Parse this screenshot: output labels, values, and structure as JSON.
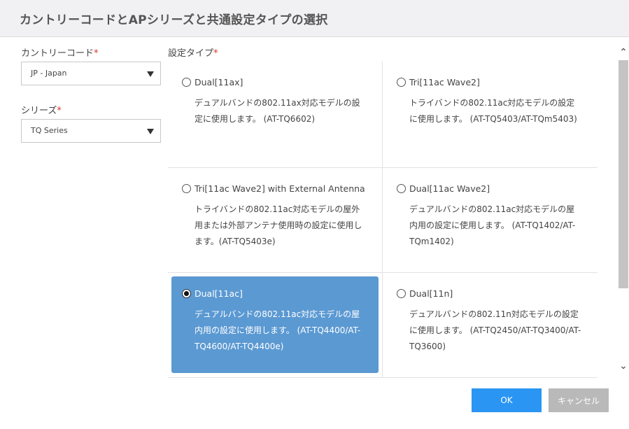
{
  "dialog": {
    "title": "カントリーコードとAPシリーズと共通設定タイプの選択"
  },
  "country": {
    "label": "カントリーコード",
    "required_mark": "*",
    "value": "JP - Japan"
  },
  "series": {
    "label": "シリーズ",
    "required_mark": "*",
    "value": "TQ Series"
  },
  "settings_type": {
    "label": "設定タイプ",
    "required_mark": "*",
    "options": [
      {
        "name": "Dual[11ax]",
        "desc": "デュアルバンドの802.11ax対応モデルの設定に使用します。 (AT-TQ6602)",
        "checked": false
      },
      {
        "name": "Tri[11ac Wave2]",
        "desc": "トライバンドの802.11ac対応モデルの設定に使用します。 (AT-TQ5403/AT-TQm5403)",
        "checked": false
      },
      {
        "name": "Tri[11ac Wave2] with External Antenna",
        "desc": "トライバンドの802.11ac対応モデルの屋外用または外部アンテナ使用時の設定に使用します。(AT-TQ5403e)",
        "checked": false
      },
      {
        "name": "Dual[11ac Wave2]",
        "desc": "デュアルバンドの802.11ac対応モデルの屋内用の設定に使用します。 (AT-TQ1402/AT-TQm1402)",
        "checked": false
      },
      {
        "name": "Dual[11ac]",
        "desc": "デュアルバンドの802.11ac対応モデルの屋内用の設定に使用します。 (AT-TQ4400/AT-TQ4600/AT-TQ4400e)",
        "checked": true
      },
      {
        "name": "Dual[11n]",
        "desc": "デュアルバンドの802.11n対応モデルの設定に使用します。 (AT-TQ2450/AT-TQ3400/AT-TQ3600)",
        "checked": false
      }
    ]
  },
  "scroll": {
    "up_icon": "chevron-up-icon",
    "down_icon": "chevron-down-icon"
  },
  "buttons": {
    "ok": "OK",
    "cancel": "キャンセル"
  },
  "colors": {
    "selected": "#5b99d2",
    "ok": "#2a95f2",
    "cancel": "#b9b9b9",
    "required": "#e0322a"
  }
}
